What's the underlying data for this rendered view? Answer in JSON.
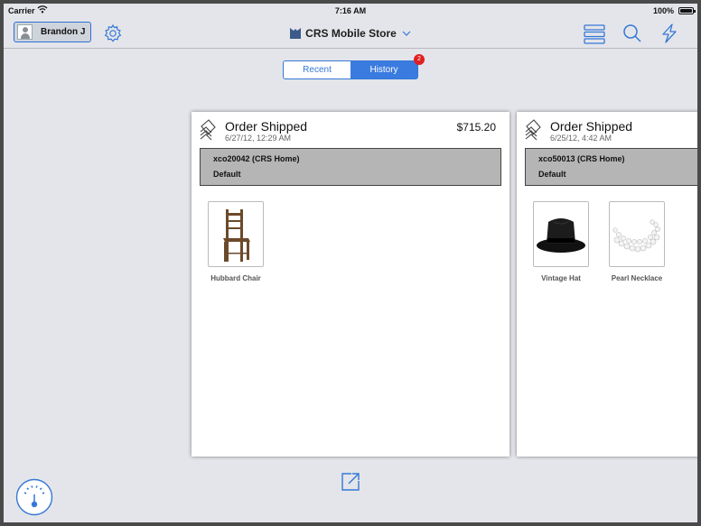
{
  "status_bar": {
    "carrier": "Carrier",
    "time": "7:16 AM",
    "battery": "100%"
  },
  "nav": {
    "user_name": "Brandon J",
    "store_title": "CRS Mobile Store"
  },
  "segment": {
    "recent": "Recent",
    "history": "History",
    "badge": "2"
  },
  "orders": [
    {
      "status": "Order Shipped",
      "date": "6/27/12, 12:29 AM",
      "total": "$715.20",
      "order_id": "xco20042 (CRS Home)",
      "shipping": "Default",
      "items": [
        {
          "name": "Hubbard Chair",
          "icon": "chair"
        }
      ]
    },
    {
      "status": "Order Shipped",
      "date": "6/25/12, 4:42 AM",
      "total": "",
      "order_id": "xco50013 (CRS Home)",
      "shipping": "Default",
      "items": [
        {
          "name": "Vintage Hat",
          "icon": "hat"
        },
        {
          "name": "Pearl Necklace",
          "icon": "necklace"
        }
      ]
    }
  ],
  "colors": {
    "accent": "#3478d6",
    "badge": "#e02020",
    "order_bar": "#b5b5b5"
  }
}
